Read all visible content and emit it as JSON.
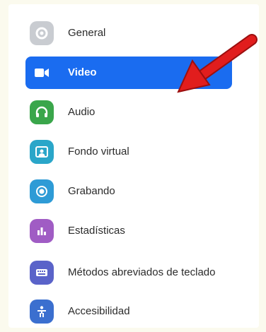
{
  "colors": {
    "accent": "#1a6cf0",
    "general": "#c9ccd1",
    "audio": "#3aa64b",
    "fondo": "#2aa6c9",
    "grabando": "#2e9bd6",
    "estadisticas": "#a05cc4",
    "metodos": "#5a63c9",
    "accesibilidad": "#3b6fcf",
    "annotation_arrow": "#e11d1d"
  },
  "sidebar": {
    "items": [
      {
        "label": "General",
        "icon": "gear-icon",
        "active": false
      },
      {
        "label": "Video",
        "icon": "video-camera-icon",
        "active": true
      },
      {
        "label": "Audio",
        "icon": "headphones-icon",
        "active": false
      },
      {
        "label": "Fondo virtual",
        "icon": "virtual-background-icon",
        "active": false
      },
      {
        "label": "Grabando",
        "icon": "record-icon",
        "active": false
      },
      {
        "label": "Estadísticas",
        "icon": "statistics-icon",
        "active": false
      },
      {
        "label": "Métodos abreviados de teclado",
        "icon": "keyboard-icon",
        "active": false
      },
      {
        "label": "Accesibilidad",
        "icon": "accessibility-icon",
        "active": false
      }
    ]
  }
}
